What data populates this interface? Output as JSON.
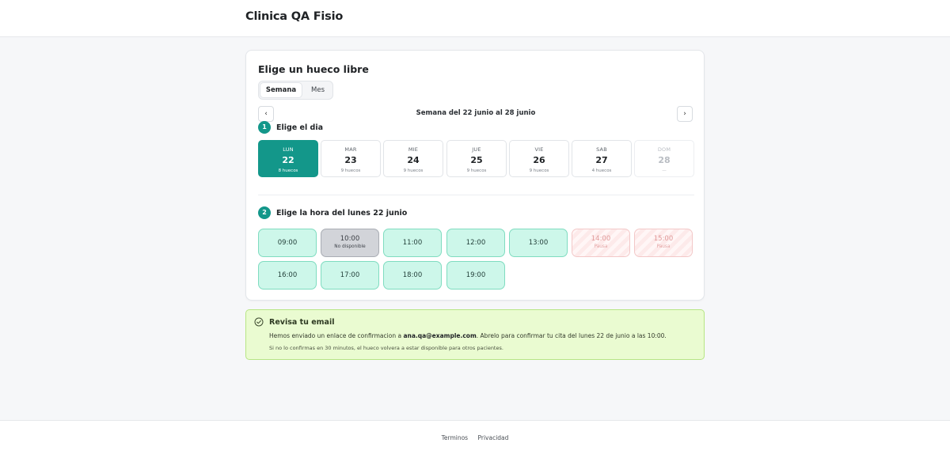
{
  "header": {
    "brand": "Clinica QA Fisio"
  },
  "booking": {
    "title": "Elige un hueco libre",
    "view_tabs": [
      {
        "label": "Semana",
        "active": true
      },
      {
        "label": "Mes",
        "active": false
      }
    ],
    "week_label": "Semana del 22 junio al 28 junio",
    "prev_icon": "chevron-left-icon",
    "next_icon": "chevron-right-icon",
    "step1": {
      "number": "1",
      "label": "Elige el dia"
    },
    "days": [
      {
        "name": "LUN",
        "num": "22",
        "count": "8 huecos",
        "state": "selected"
      },
      {
        "name": "MAR",
        "num": "23",
        "count": "9 huecos",
        "state": "available"
      },
      {
        "name": "MIE",
        "num": "24",
        "count": "9 huecos",
        "state": "available"
      },
      {
        "name": "JUE",
        "num": "25",
        "count": "9 huecos",
        "state": "available"
      },
      {
        "name": "VIE",
        "num": "26",
        "count": "9 huecos",
        "state": "available"
      },
      {
        "name": "SAB",
        "num": "27",
        "count": "4 huecos",
        "state": "available"
      },
      {
        "name": "DOM",
        "num": "28",
        "count": "—",
        "state": "disabled"
      }
    ],
    "step2": {
      "number": "2",
      "label": "Elige la hora del lunes 22 junio"
    },
    "slots": [
      {
        "time": "09:00",
        "sub": "",
        "state": "free"
      },
      {
        "time": "10:00",
        "sub": "No disponible",
        "state": "busy"
      },
      {
        "time": "11:00",
        "sub": "",
        "state": "free"
      },
      {
        "time": "12:00",
        "sub": "",
        "state": "free"
      },
      {
        "time": "13:00",
        "sub": "",
        "state": "free"
      },
      {
        "time": "14:00",
        "sub": "Pausa",
        "state": "pause"
      },
      {
        "time": "15:00",
        "sub": "Pausa",
        "state": "pause"
      },
      {
        "time": "16:00",
        "sub": "",
        "state": "free"
      },
      {
        "time": "17:00",
        "sub": "",
        "state": "free"
      },
      {
        "time": "18:00",
        "sub": "",
        "state": "free"
      },
      {
        "time": "19:00",
        "sub": "",
        "state": "free"
      }
    ]
  },
  "notice": {
    "icon": "check-circle-icon",
    "title": "Revisa tu email",
    "line1_prefix": "Hemos enviado un enlace de confirmacion a ",
    "email": "ana.qa@example.com",
    "line1_suffix": ". Abrelo para confirmar tu cita del lunes 22 de junio a las 10:00.",
    "line2": "Si no lo confirmas en 30 minutos, el hueco volvera a estar disponible para otros pacientes."
  },
  "footer": {
    "links": [
      "Terminos",
      "Privacidad"
    ]
  },
  "colors": {
    "accent": "#13978a",
    "slot_free_bg": "#cdf7ea",
    "slot_busy_bg": "#d2d4d9",
    "notice_bg": "#eafbd1"
  }
}
